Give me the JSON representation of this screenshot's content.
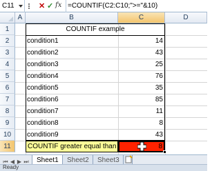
{
  "formula_bar": {
    "name_box": "C11",
    "formula": "=COUNTIF(C2:C10;\">=\"&10)"
  },
  "columns": [
    "A",
    "B",
    "C",
    "D"
  ],
  "selected_column": "C",
  "rows": [
    "1",
    "2",
    "3",
    "4",
    "5",
    "6",
    "7",
    "8",
    "9",
    "10",
    "11"
  ],
  "selected_row": "11",
  "sheet": {
    "title": "COUNTIF example",
    "items": [
      {
        "label": "condition1",
        "value": "14"
      },
      {
        "label": "condition2",
        "value": "43"
      },
      {
        "label": "condition3",
        "value": "25"
      },
      {
        "label": "condition4",
        "value": "76"
      },
      {
        "label": "condition5",
        "value": "35"
      },
      {
        "label": "condition6",
        "value": "85"
      },
      {
        "label": "condition7",
        "value": "11"
      },
      {
        "label": "condition8",
        "value": "8"
      },
      {
        "label": "condition9",
        "value": "43"
      }
    ],
    "result_label": "COUNTIF greater equal than",
    "result_value": "8"
  },
  "colors": {
    "result_label_bg": "#ffff99",
    "result_value_bg": "#ff2200",
    "selected_header": "#f3c56d"
  },
  "tabs": [
    "Sheet1",
    "Sheet2",
    "Sheet3"
  ],
  "active_tab": "Sheet1",
  "status": {
    "mode": "Ready"
  }
}
